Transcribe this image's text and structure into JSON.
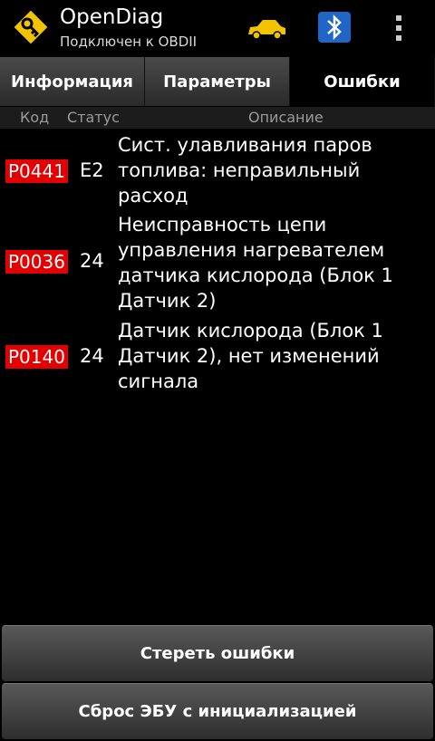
{
  "app": {
    "title": "OpenDiag",
    "subtitle": "Подключен к OBDII",
    "icons": [
      "app-logo-icon",
      "car-icon",
      "bluetooth-icon",
      "overflow-menu-icon"
    ],
    "accent_color": "#f2c400"
  },
  "tabs": [
    {
      "label": "Информация",
      "active": false
    },
    {
      "label": "Параметры",
      "active": false
    },
    {
      "label": "Ошибки",
      "active": true
    }
  ],
  "columns": {
    "code": "Код",
    "status": "Статус",
    "description": "Описание"
  },
  "errors": [
    {
      "code": "P0441",
      "status": "E2",
      "description": "Сист. улавливания паров топлива: неправильный расход"
    },
    {
      "code": "P0036",
      "status": "24",
      "description": "Неисправность цепи управления нагревателем датчика кислорода (Блок 1 Датчик 2)"
    },
    {
      "code": "P0140",
      "status": "24",
      "description": "Датчик кислорода (Блок 1 Датчик 2), нет изменений сигнала"
    }
  ],
  "buttons": {
    "clear_errors": "Стереть ошибки",
    "reset_ecu": "Сброс ЭБУ с инициализацией"
  },
  "colors": {
    "error_code_bg": "#e40000",
    "background": "#000000"
  }
}
